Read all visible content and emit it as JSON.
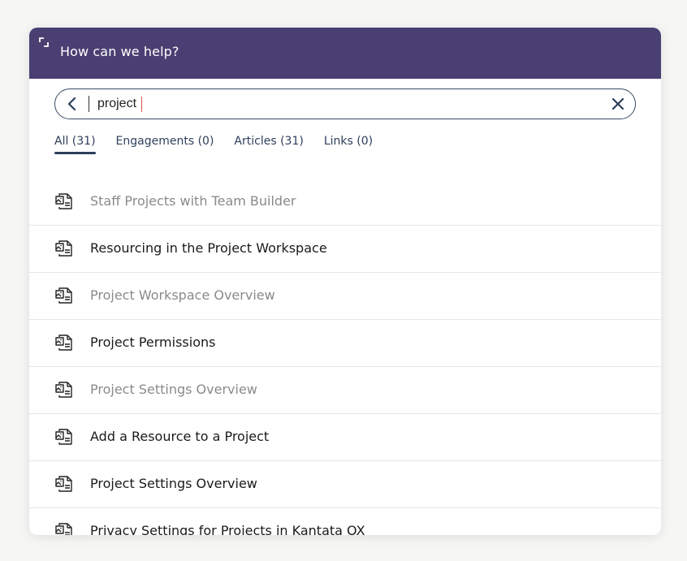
{
  "header": {
    "title": "How can we help?",
    "expand_icon": "expand-icon",
    "background": "#4a3f72"
  },
  "search": {
    "value": "project",
    "back_icon": "chevron-left-icon",
    "clear_icon": "close-icon"
  },
  "tabs": [
    {
      "label": "All (31)",
      "active": true
    },
    {
      "label": "Engagements (0)",
      "active": false
    },
    {
      "label": "Articles (31)",
      "active": false
    },
    {
      "label": "Links (0)",
      "active": false
    }
  ],
  "results": [
    {
      "title": "Staff Projects with Team Builder",
      "visited": true,
      "icon": "article-icon"
    },
    {
      "title": "Resourcing in the Project Workspace",
      "visited": false,
      "icon": "article-icon"
    },
    {
      "title": "Project Workspace Overview",
      "visited": true,
      "icon": "article-icon"
    },
    {
      "title": "Project Permissions",
      "visited": false,
      "icon": "article-icon"
    },
    {
      "title": "Project Settings Overview",
      "visited": true,
      "icon": "article-icon"
    },
    {
      "title": "Add a Resource to a Project",
      "visited": false,
      "icon": "article-icon"
    },
    {
      "title": "Project Settings Overview",
      "visited": false,
      "icon": "article-icon"
    },
    {
      "title": "Privacy Settings for Projects in Kantata OX",
      "visited": false,
      "icon": "article-icon"
    }
  ]
}
